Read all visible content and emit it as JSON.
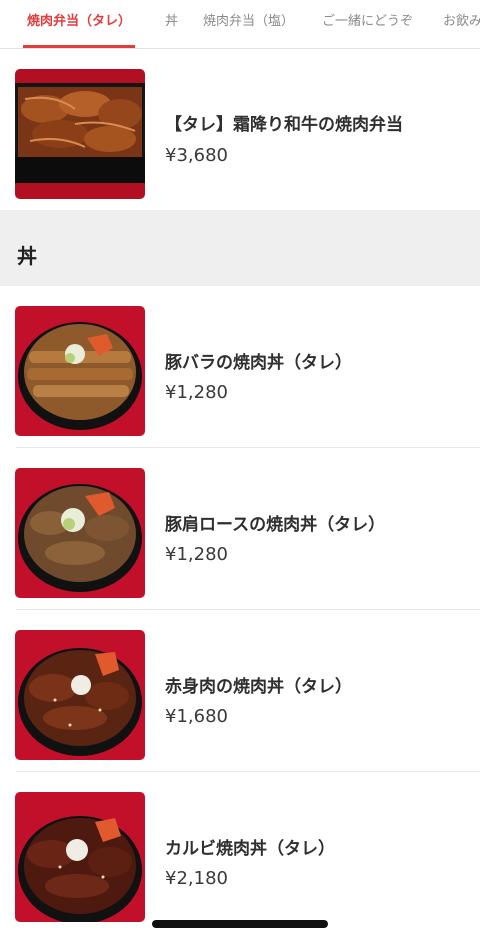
{
  "tabs": [
    {
      "label": "焼肉弁当（タレ）",
      "active": true
    },
    {
      "label": "丼",
      "active": false
    },
    {
      "label": "焼肉弁当（塩）",
      "active": false
    },
    {
      "label": "ご一緒にどうぞ",
      "active": false
    },
    {
      "label": "お飲み",
      "active": false
    }
  ],
  "bento_items": [
    {
      "name": "【タレ】霜降り和牛の焼肉弁当",
      "price": "¥3,680"
    }
  ],
  "sections": {
    "don": {
      "title": "丼"
    }
  },
  "don_items": [
    {
      "name": "豚バラの焼肉丼（タレ）",
      "price": "¥1,280"
    },
    {
      "name": "豚肩ロースの焼肉丼（タレ）",
      "price": "¥1,280"
    },
    {
      "name": "赤身肉の焼肉丼（タレ）",
      "price": "¥1,680"
    },
    {
      "name": "カルビ焼肉丼（タレ）",
      "price": "¥2,180"
    }
  ],
  "colors": {
    "accent": "#e43b3b",
    "section_bg": "#efefef",
    "thumb_bg": "#c8102e"
  },
  "icons": {
    "food_photo": "food-photo-icon"
  }
}
